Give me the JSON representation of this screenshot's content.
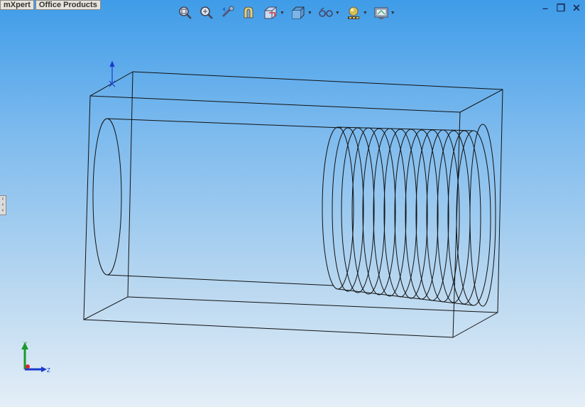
{
  "tabs": {
    "tab1": "mXpert",
    "tab2": "Office Products"
  },
  "toolbar": {
    "items": [
      {
        "icon": "zoom-to-fit-icon"
      },
      {
        "icon": "zoom-to-area-icon"
      },
      {
        "icon": "previous-view-icon"
      },
      {
        "icon": "section-view-icon"
      },
      {
        "icon": "view-orientation-icon"
      },
      {
        "icon": "display-style-icon"
      },
      {
        "icon": "hide-show-items-icon"
      },
      {
        "icon": "edit-appearance-icon"
      },
      {
        "icon": "apply-scene-icon"
      }
    ]
  },
  "window": {
    "minimize": "–",
    "restore": "❐",
    "close": "✕"
  },
  "triad": {
    "y": "Y",
    "z": "Z"
  }
}
